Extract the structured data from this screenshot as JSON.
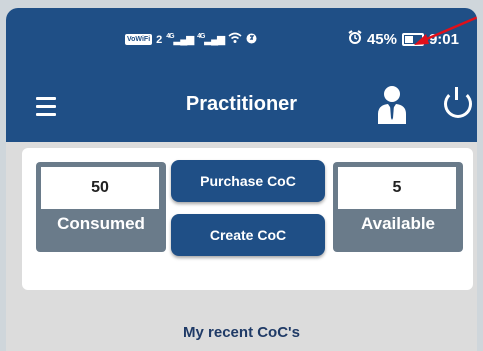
{
  "status_bar": {
    "volte": "VoWiFi",
    "sim": "2",
    "network1": "4G",
    "network2": "4G",
    "battery": "45%",
    "time": "9:01"
  },
  "app_bar": {
    "title": "Practitioner"
  },
  "stats": {
    "consumed": {
      "value": "50",
      "label": "Consumed"
    },
    "available": {
      "value": "5",
      "label": "Available"
    }
  },
  "actions": {
    "purchase": "Purchase CoC",
    "create": "Create CoC"
  },
  "recent_heading": "My recent CoC's",
  "colors": {
    "primary": "#1f4f86",
    "stat_bg": "#6a7b8a",
    "annotation_arrow": "#e0101a"
  }
}
